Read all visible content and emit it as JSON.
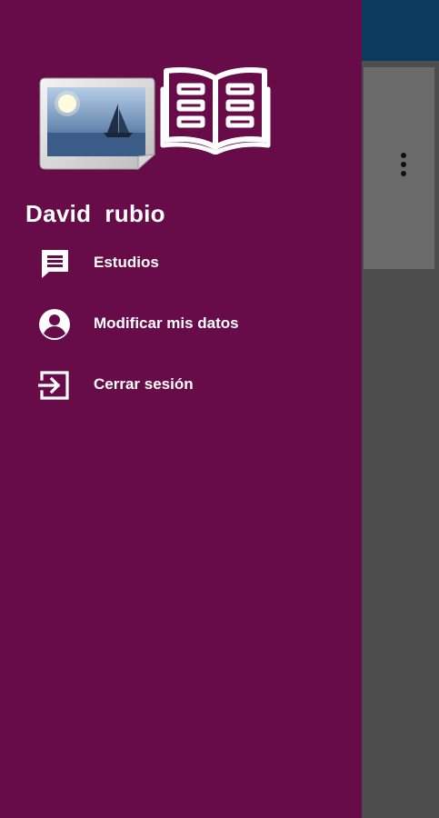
{
  "user": {
    "name": "David  rubio"
  },
  "drawer": {
    "background_color": "#680c49",
    "header_images": [
      "landscape-photo-icon",
      "book-icon"
    ],
    "menu": [
      {
        "label": "Estudios",
        "icon": "message-icon"
      },
      {
        "label": "Modificar mis datos",
        "icon": "account-circle-icon"
      },
      {
        "label": "Cerrar sesión",
        "icon": "logout-icon"
      }
    ]
  },
  "background_app": {
    "topbar_color": "#0b3a5e",
    "menu_icon": "more-vertical-icon"
  }
}
